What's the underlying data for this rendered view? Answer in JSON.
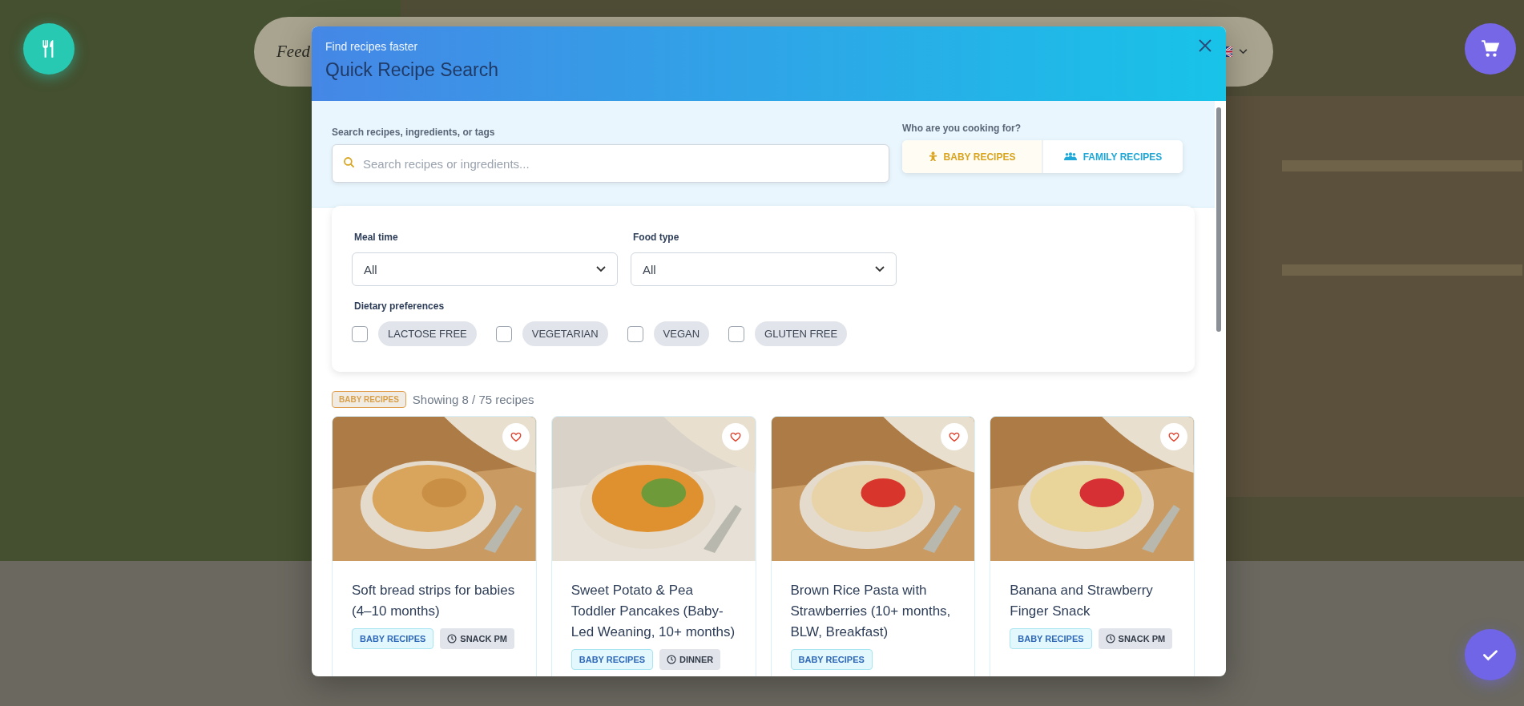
{
  "nav": {
    "logo": "Feed"
  },
  "modal": {
    "subtitle": "Find recipes faster",
    "title": "Quick Recipe Search"
  },
  "search": {
    "label": "Search recipes, ingredients, or tags",
    "placeholder": "Search recipes or ingredients..."
  },
  "audience": {
    "label": "Who are you cooking for?",
    "options": [
      {
        "label": "BABY RECIPES",
        "kind": "baby",
        "selected": true
      },
      {
        "label": "FAMILY RECIPES",
        "kind": "family",
        "selected": false
      }
    ]
  },
  "filters": {
    "meal_time": {
      "label": "Meal time",
      "value": "All"
    },
    "food_type": {
      "label": "Food type",
      "value": "All"
    },
    "dietary": {
      "label": "Dietary preferences",
      "options": [
        {
          "label": "LACTOSE FREE",
          "checked": false
        },
        {
          "label": "VEGETARIAN",
          "checked": false
        },
        {
          "label": "VEGAN",
          "checked": false
        },
        {
          "label": "GLUTEN FREE",
          "checked": false
        }
      ]
    }
  },
  "results": {
    "badge": "BABY RECIPES",
    "count": "Showing 8 / 75 recipes"
  },
  "recipes": [
    {
      "title": "Soft bread strips for babies (4–10 months)",
      "favorite": false,
      "tags": [
        {
          "label": "BABY RECIPES",
          "kind": "category"
        },
        {
          "label": "SNACK PM",
          "kind": "meal"
        }
      ]
    },
    {
      "title": "Sweet Potato & Pea Toddler Pancakes (Baby-Led Weaning, 10+ months)",
      "favorite": false,
      "tags": [
        {
          "label": "BABY RECIPES",
          "kind": "category"
        },
        {
          "label": "DINNER",
          "kind": "meal"
        }
      ]
    },
    {
      "title": "Brown Rice Pasta with Strawberries (10+ months, BLW, Breakfast)",
      "favorite": false,
      "tags": [
        {
          "label": "BABY RECIPES",
          "kind": "category"
        }
      ]
    },
    {
      "title": "Banana and Strawberry Finger Snack",
      "favorite": false,
      "tags": [
        {
          "label": "BABY RECIPES",
          "kind": "category"
        },
        {
          "label": "SNACK PM",
          "kind": "meal"
        }
      ]
    }
  ]
}
